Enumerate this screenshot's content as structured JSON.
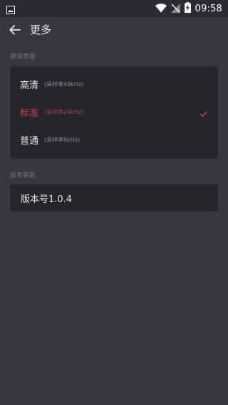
{
  "status_bar": {
    "time": "09:58",
    "icons": [
      "image-icon",
      "wifi-icon",
      "no-signal-icon",
      "battery-charging-icon"
    ]
  },
  "app_bar": {
    "back_icon": "arrow-left-icon",
    "title": "更多"
  },
  "audio_quality": {
    "section_label": "录音质量",
    "options": [
      {
        "label": "高清",
        "detail": "(采样率48kHz)",
        "selected": false
      },
      {
        "label": "标准",
        "detail": "(采样率24kHz)",
        "selected": true
      },
      {
        "label": "普通",
        "detail": "(采样率8kHz)",
        "selected": false
      }
    ],
    "check_icon": "checkmark-icon"
  },
  "version": {
    "section_label": "版本更新",
    "text": "版本号1.0.4"
  },
  "colors": {
    "background": "#383642",
    "card": "#26252c",
    "accent": "#c8454d",
    "status_bar": "#2b2932"
  }
}
